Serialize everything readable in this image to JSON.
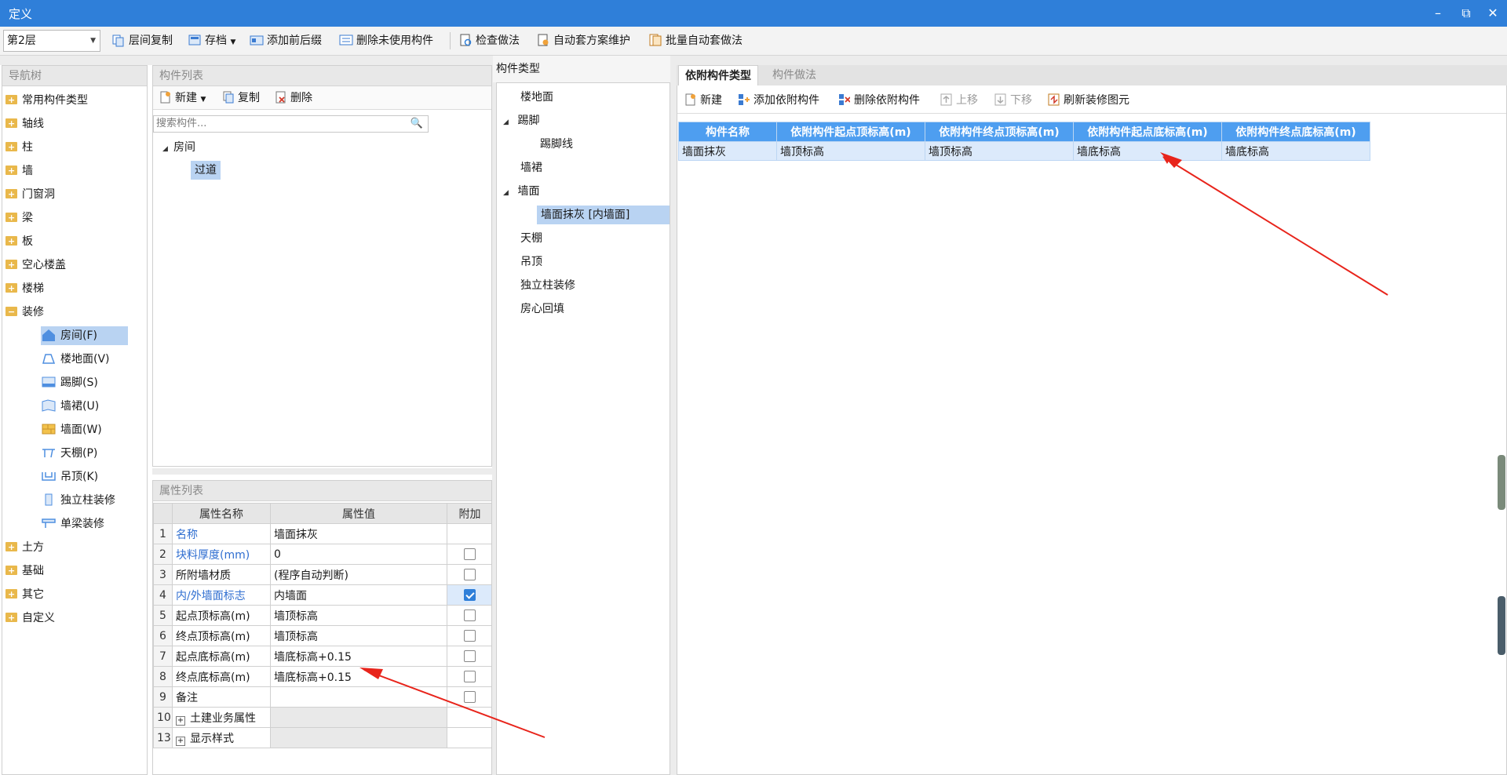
{
  "window": {
    "title": "定义",
    "min_icon": "minimize-icon",
    "restore_icon": "restore-icon",
    "close_icon": "close-icon"
  },
  "toolbar": {
    "floor": "第2层",
    "buttons": [
      "层间复制",
      "存档",
      "添加前后缀",
      "删除未使用构件",
      "检查做法",
      "自动套方案维护",
      "批量自动套做法"
    ]
  },
  "nav": {
    "header": "导航树",
    "items": [
      "常用构件类型",
      "轴线",
      "柱",
      "墙",
      "门窗洞",
      "梁",
      "板",
      "空心楼盖",
      "楼梯",
      "装修"
    ],
    "sub_items": [
      "房间(F)",
      "楼地面(V)",
      "踢脚(S)",
      "墙裙(U)",
      "墙面(W)",
      "天棚(P)",
      "吊顶(K)",
      "独立柱装修",
      "单梁装修"
    ],
    "bottom_items": [
      "土方",
      "基础",
      "其它",
      "自定义"
    ]
  },
  "component_list": {
    "header": "构件列表",
    "new": "新建",
    "copy": "复制",
    "delete": "删除",
    "search_placeholder": "搜索构件...",
    "tree_parent": "房间",
    "tree_child": "过道"
  },
  "properties": {
    "header": "属性列表",
    "col_name": "属性名称",
    "col_value": "属性值",
    "col_extra": "附加",
    "rows": [
      {
        "num": "1",
        "name": "名称",
        "value": "墙面抹灰"
      },
      {
        "num": "2",
        "name": "块料厚度(mm)",
        "value": "0"
      },
      {
        "num": "3",
        "name": "所附墙材质",
        "value": "(程序自动判断)"
      },
      {
        "num": "4",
        "name": "内/外墙面标志",
        "value": "内墙面"
      },
      {
        "num": "5",
        "name": "起点顶标高(m)",
        "value": "墙顶标高"
      },
      {
        "num": "6",
        "name": "终点顶标高(m)",
        "value": "墙顶标高"
      },
      {
        "num": "7",
        "name": "起点底标高(m)",
        "value": "墙底标高+0.15"
      },
      {
        "num": "8",
        "name": "终点底标高(m)",
        "value": "墙底标高+0.15"
      },
      {
        "num": "9",
        "name": "备注",
        "value": ""
      },
      {
        "num": "10",
        "name": "土建业务属性",
        "value": ""
      },
      {
        "num": "13",
        "name": "显示样式",
        "value": ""
      }
    ]
  },
  "component_types": {
    "header": "构件类型",
    "items": [
      "楼地面",
      "踢脚",
      "踢脚线",
      "墙裙",
      "墙面",
      "墙面抹灰 [内墙面]",
      "天棚",
      "吊顶",
      "独立柱装修",
      "房心回填"
    ]
  },
  "right": {
    "tab_active": "依附构件类型",
    "tab_inactive": "构件做法",
    "btn_new": "新建",
    "btn_add": "添加依附构件",
    "btn_del": "删除依附构件",
    "btn_up": "上移",
    "btn_down": "下移",
    "btn_refresh": "刷新装修图元",
    "table_headers": [
      "构件名称",
      "依附构件起点顶标高(m)",
      "依附构件终点顶标高(m)",
      "依附构件起点底标高(m)",
      "依附构件终点底标高(m)"
    ],
    "table_row": [
      "墙面抹灰",
      "墙顶标高",
      "墙顶标高",
      "墙底标高",
      "墙底标高"
    ]
  },
  "colors": {
    "title_bar": "#2f7fd9",
    "selection": "#b9d3f2",
    "grid_header": "#4e9ef0",
    "annotation_arrow": "#e8241b"
  }
}
